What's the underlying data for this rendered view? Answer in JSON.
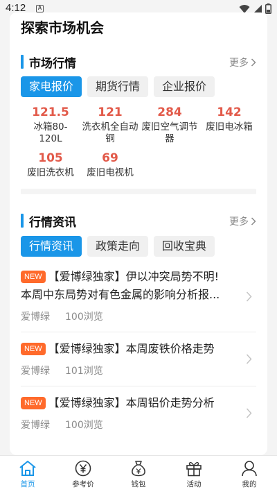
{
  "status": {
    "time": "4:12",
    "app_icon": "A"
  },
  "page": {
    "title": "探索市场机会"
  },
  "market": {
    "title": "市场行情",
    "more": "更多",
    "tabs": [
      "家电报价",
      "期货行情",
      "企业报价"
    ],
    "prices": [
      {
        "value": "121.5",
        "name": "冰箱80-120L"
      },
      {
        "value": "121",
        "name": "洗衣机全自动铜"
      },
      {
        "value": "284",
        "name": "废旧空气调节器"
      },
      {
        "value": "142",
        "name": "废旧电冰箱"
      },
      {
        "value": "105",
        "name": "废旧洗衣机"
      },
      {
        "value": "69",
        "name": "废旧电视机"
      }
    ]
  },
  "news": {
    "title": "行情资讯",
    "more": "更多",
    "tabs": [
      "行情资讯",
      "政策走向",
      "回收宝典"
    ],
    "items": [
      {
        "badge": "NEW",
        "line1": "【爱博绿独家】伊以冲突局势不明!",
        "line2": "本周中东局势对有色金属的影响分析报...",
        "source": "爱博绿",
        "views": "100浏览"
      },
      {
        "badge": "NEW",
        "line1": "【爱博绿独家】本周废铁价格走势",
        "line2": "",
        "source": "爱博绿",
        "views": "101浏览"
      },
      {
        "badge": "NEW",
        "line1": "【爱博绿独家】本周铝价走势分析",
        "line2": "",
        "source": "爱博绿",
        "views": "100浏览"
      }
    ]
  },
  "nav": [
    {
      "label": "首页",
      "icon": "home-icon",
      "active": true
    },
    {
      "label": "参考价",
      "icon": "yuan-icon",
      "active": false
    },
    {
      "label": "钱包",
      "icon": "wallet-icon",
      "active": false
    },
    {
      "label": "活动",
      "icon": "gift-icon",
      "active": false
    },
    {
      "label": "我的",
      "icon": "user-icon",
      "active": false
    }
  ],
  "colors": {
    "accent": "#1a96e8",
    "price": "#e25a4a",
    "badge": "#ff6a2b"
  }
}
